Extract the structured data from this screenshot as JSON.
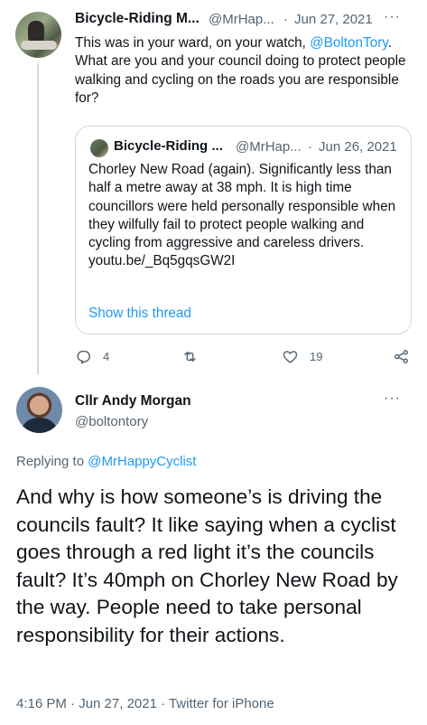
{
  "parent_tweet": {
    "display_name": "Bicycle-Riding M...",
    "handle": "@MrHap...",
    "separator": "·",
    "date": "Jun 27, 2021",
    "more": "···",
    "text_before": "This was in your ward, on your watch, ",
    "mention": "@BoltonTory",
    "text_after": ". What are you and your council doing to protect people walking and cycling on the roads you are responsible for?",
    "quoted": {
      "display_name": "Bicycle-Riding ...",
      "handle": "@MrHap...",
      "separator": "·",
      "date": "Jun 26, 2021",
      "text": "Chorley New Road (again). Significantly less than half a metre away at 38 mph. It is high time councillors were held personally responsible when they wilfully fail to protect people walking and cycling from aggressive and careless drivers.",
      "link": "youtu.be/_Bq5gqsGW2I",
      "show_thread": "Show this thread"
    },
    "actions": {
      "reply_count": "4",
      "retweet_count": "",
      "like_count": "19"
    }
  },
  "main_tweet": {
    "display_name": "Cllr Andy Morgan",
    "handle": "@boltontory",
    "more": "···",
    "replying_prefix": "Replying to ",
    "replying_handle": "@MrHappyCyclist",
    "text": "And why is how someone’s is driving the councils fault? It like saying when a cyclist goes through a red light it’s the councils fault?  It’s 40mph on Chorley New Road by the way.  People need to take personal responsibility for their actions.",
    "meta": "4:16 PM · Jun 27, 2021 · Twitter for iPhone"
  },
  "colors": {
    "text": "#0f1419",
    "secondary": "#536471",
    "link": "#1d9bf0",
    "border": "#cfd9de"
  }
}
